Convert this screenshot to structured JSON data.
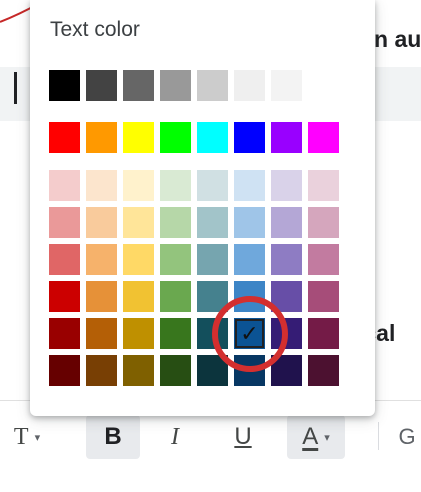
{
  "background": {
    "right_text_top": "n au",
    "right_text_mid": "ical"
  },
  "picker": {
    "title": "Text color",
    "selected": {
      "row": 6,
      "col": 5
    },
    "rows": [
      [
        "#000000",
        "#434343",
        "#666666",
        "#999999",
        "#cccccc",
        "#efefef",
        "#f3f3f3"
      ],
      [
        "#ff0000",
        "#ff9900",
        "#ffff00",
        "#00ff00",
        "#00ffff",
        "#0000ff",
        "#9900ff",
        "#ff00ff"
      ],
      [
        "#f4cccc",
        "#fce5cd",
        "#fff2cc",
        "#d9ead3",
        "#d0e0e3",
        "#cfe2f3",
        "#d9d2e9",
        "#ead1dc"
      ],
      [
        "#ea9999",
        "#f9cb9c",
        "#ffe599",
        "#b6d7a8",
        "#a2c4c9",
        "#9fc5e8",
        "#b4a7d6",
        "#d5a6bd"
      ],
      [
        "#e06666",
        "#f6b26b",
        "#ffd966",
        "#93c47d",
        "#76a5af",
        "#6fa8dc",
        "#8e7cc3",
        "#c27ba0"
      ],
      [
        "#cc0000",
        "#e69138",
        "#f1c232",
        "#6aa84f",
        "#45818e",
        "#3d85c6",
        "#674ea7",
        "#a64d79"
      ],
      [
        "#990000",
        "#b45f06",
        "#bf9000",
        "#38761d",
        "#134f5c",
        "#0b5394",
        "#351c75",
        "#741b47"
      ],
      [
        "#660000",
        "#783f04",
        "#7f6000",
        "#274e13",
        "#0c343d",
        "#073763",
        "#20124d",
        "#4c1130"
      ]
    ],
    "check_mark": "✓",
    "highlight_color": "#d32f2f"
  },
  "toolbar": {
    "font_label": "T",
    "bold_label": "B",
    "italic_label": "I",
    "underline_label": "U",
    "text_color_label": "A",
    "caret": "▾",
    "link_label": "G"
  }
}
